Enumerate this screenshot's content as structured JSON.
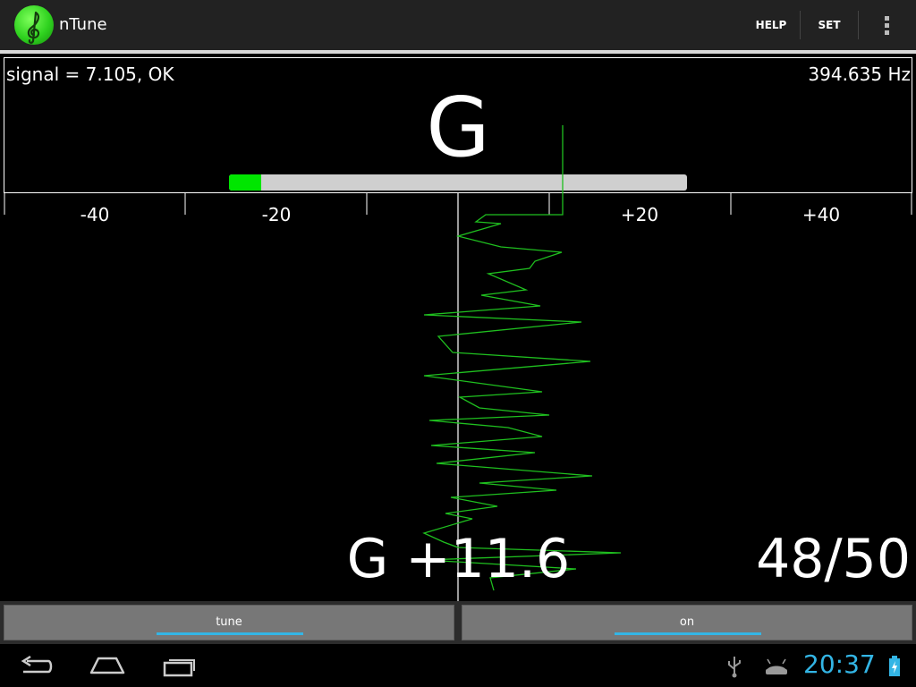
{
  "app": {
    "title": "nTune"
  },
  "actionbar": {
    "help_label": "HELP",
    "set_label": "SET"
  },
  "tuner": {
    "signal_text": "signal = 7.105, OK",
    "frequency_text": "394.635 Hz",
    "note": "G",
    "level_fraction": 0.07,
    "scale_labels": [
      "-40",
      "-20",
      "+20",
      "+40"
    ],
    "result_note": "G +11.6",
    "result_count": "48/50"
  },
  "buttons": {
    "tune_label": "tune",
    "on_label": "on"
  },
  "status": {
    "time": "20:37"
  },
  "colors": {
    "accent": "#33b5e5",
    "trace": "#1fbf1f",
    "level": "#00e600",
    "track": "#cfcfcf"
  }
}
